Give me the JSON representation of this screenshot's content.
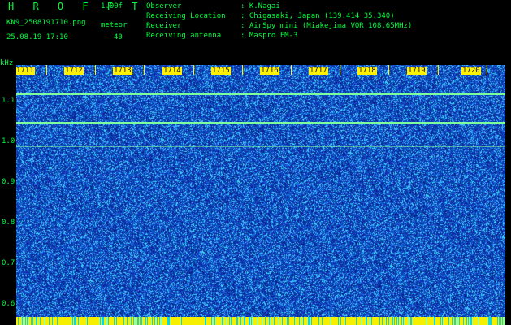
{
  "header": {
    "app_title": "H R O F F T",
    "version": "1.00f",
    "filename": "KN9_2508191710.png",
    "meteor_label": "meteor",
    "meteor_count": "40",
    "timestamp": "25.08.19 17:10"
  },
  "info": [
    {
      "label": "Observer",
      "value": ": K.Nagai"
    },
    {
      "label": "Receiving Location",
      "value": ": Chigasaki, Japan (139.414 35.340)"
    },
    {
      "label": "Receiver",
      "value": ": AirSpy mini (Miakejima VOR 108.65MHz)"
    },
    {
      "label": "Receiving antenna",
      "value": ": Maspro FM-3"
    }
  ],
  "axes": {
    "y_unit": "kHz",
    "y_ticks": [
      "1.1",
      "1.0",
      "0.9",
      "0.8",
      "0.7",
      "0.6"
    ],
    "y_range": [
      0.57,
      1.19
    ],
    "x_ticks": [
      "1711",
      "1712",
      "1713",
      "1714",
      "1715",
      "1716",
      "1717",
      "1718",
      "1719",
      "1720"
    ]
  },
  "tones_khz": [
    1.12,
    1.05,
    0.99,
    0.62
  ],
  "colors": {
    "background": "#000000",
    "text": "#00ff3c",
    "plot_bg": "#0a2894",
    "noise_bright": "#3fd8ff",
    "noise_mid": "#1850d8",
    "tone": "#7dff9d",
    "tick_bg": "#fff100",
    "strip": "#f7ef00",
    "strip_bars": "#00d9ff"
  }
}
